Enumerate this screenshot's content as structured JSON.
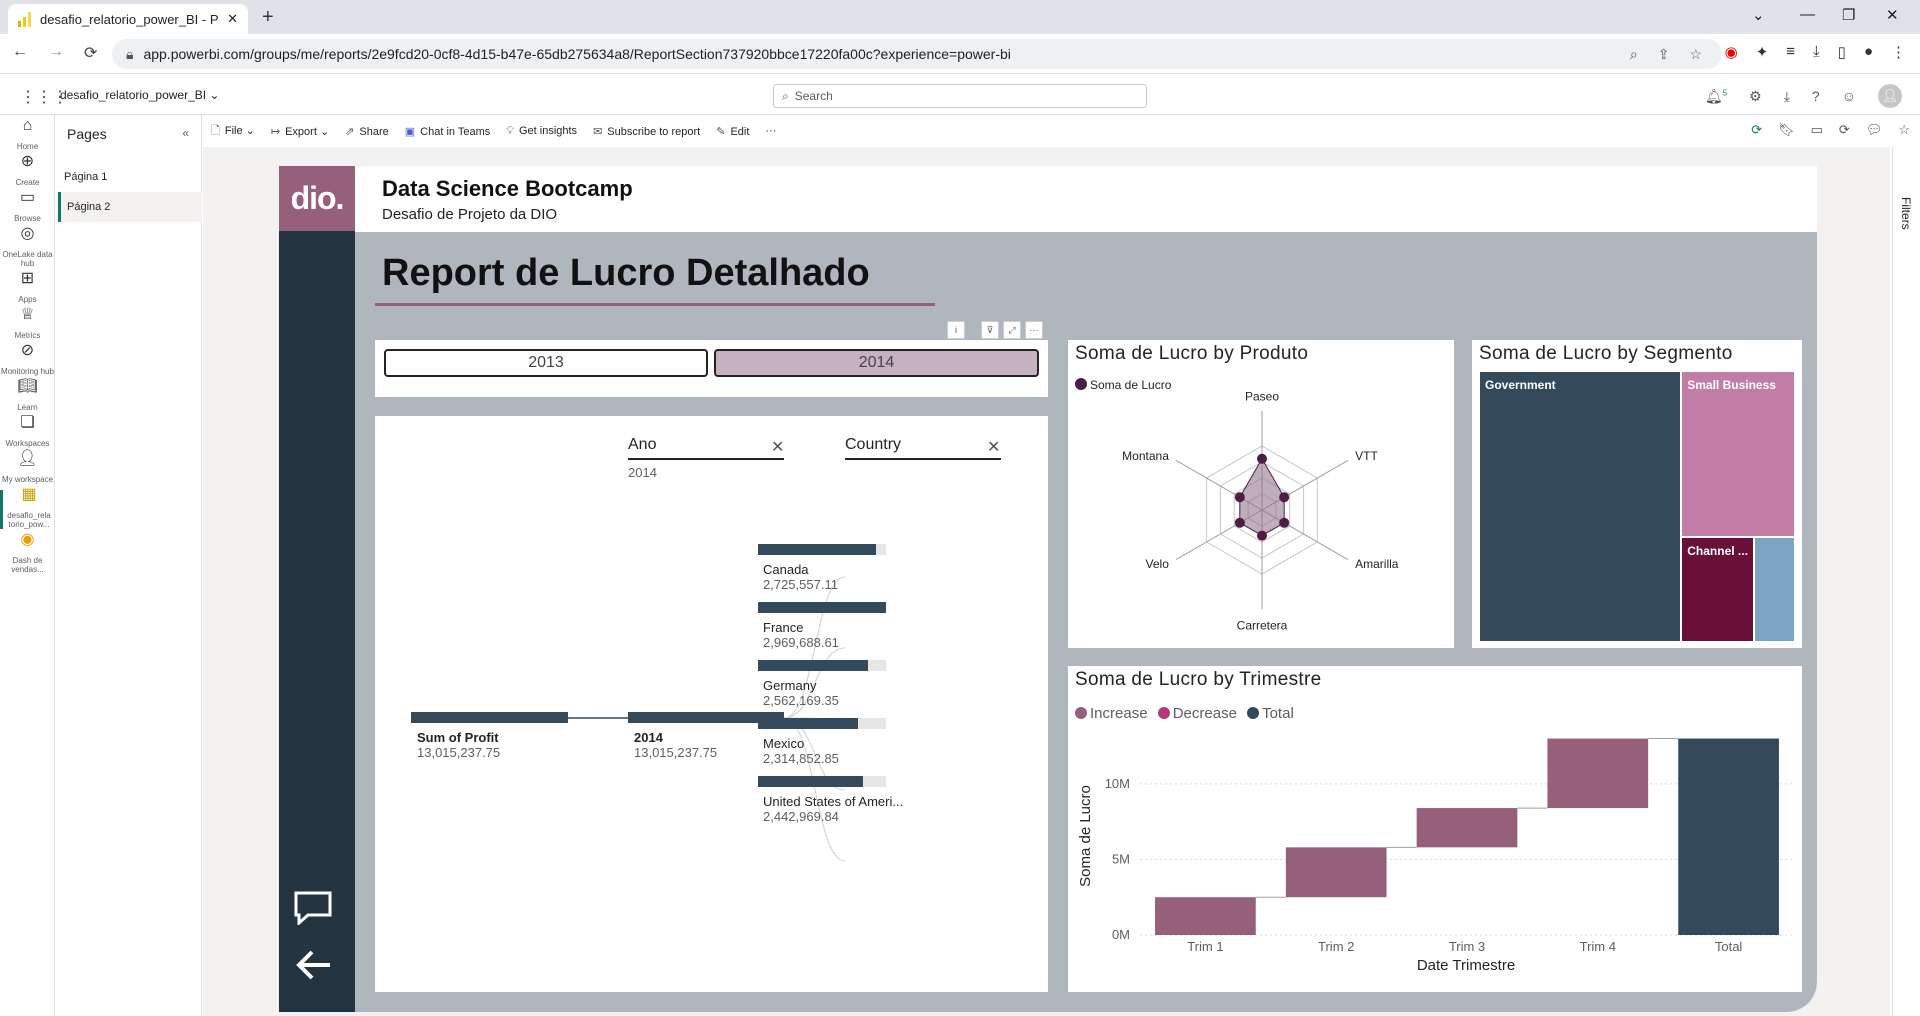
{
  "browser": {
    "tab_title": "desafio_relatorio_power_BI - Pov",
    "url": "app.powerbi.com/groups/me/reports/2e9fcd20-0cf8-4d15-b47e-65db275634a8/ReportSection737920bbce17220fa00c?experience=power-bi"
  },
  "header": {
    "report_name": "desafio_relatorio_power_BI",
    "search_placeholder": "Search",
    "notif_count": "5"
  },
  "rail": {
    "home": "Home",
    "create": "Create",
    "browse": "Browse",
    "onelake": "OneLake data hub",
    "apps": "Apps",
    "metrics": "Metrics",
    "monitoring": "Monitoring hub",
    "learn": "Learn",
    "workspaces": "Workspaces",
    "my_workspace": "My workspace",
    "current": "desafio_rela torio_pow...",
    "dash": "Dash de vendas..."
  },
  "pages_pane": {
    "title": "Pages",
    "pages": [
      "Página 1",
      "Página 2"
    ]
  },
  "actionbar": {
    "file": "File",
    "export": "Export",
    "share": "Share",
    "teams": "Chat in Teams",
    "insights": "Get insights",
    "subscribe": "Subscribe to report",
    "edit": "Edit"
  },
  "filters_label": "Filters",
  "report": {
    "logo": "dio.",
    "title": "Data Science Bootcamp",
    "subtitle": "Desafio de Projeto da DIO",
    "main_title": "Report de Lucro Detalhado",
    "slicer": {
      "options": [
        "2013",
        "2014"
      ],
      "selected": "2014"
    },
    "decomp": {
      "col1": "Ano",
      "col1_value": "2014",
      "col2": "Country",
      "root_label": "Sum of Profit",
      "root_value": "13,015,237.75",
      "level1_label": "2014",
      "level1_value": "13,015,237.75",
      "countries": [
        {
          "name": "Canada",
          "value": "2,725,557.11",
          "fraction": 0.92
        },
        {
          "name": "France",
          "value": "2,969,688.61",
          "fraction": 1.0
        },
        {
          "name": "Germany",
          "value": "2,562,169.35",
          "fraction": 0.86
        },
        {
          "name": "Mexico",
          "value": "2,314,852.85",
          "fraction": 0.78
        },
        {
          "name": "United States of Ameri...",
          "value": "2,442,969.84",
          "fraction": 0.82
        }
      ]
    }
  },
  "colors": {
    "purple": "#96607d",
    "dark": "#34495a",
    "pink": "#c27da6",
    "maroon": "#6a0f37",
    "blue": "#7ba3c2",
    "decrease": "#b23c7b"
  },
  "chart_data": [
    {
      "type": "radar",
      "title": "Soma de Lucro by Produto",
      "legend": [
        "Soma de Lucro"
      ],
      "categories": [
        "Paseo",
        "VTT",
        "Amarilla",
        "Carretera",
        "Velo",
        "Montana"
      ],
      "values": [
        0.8,
        0.4,
        0.4,
        0.4,
        0.4,
        0.4
      ]
    },
    {
      "type": "treemap",
      "title": "Soma de Lucro by Segmento",
      "categories": [
        "Government",
        "Small Business",
        "Channel ...",
        ""
      ],
      "values": [
        0.64,
        0.22,
        0.09,
        0.05
      ]
    },
    {
      "type": "waterfall",
      "title": "Soma de Lucro by Trimestre",
      "legend": [
        "Increase",
        "Decrease",
        "Total"
      ],
      "categories": [
        "Trim 1",
        "Trim 2",
        "Trim 3",
        "Trim 4",
        "Total"
      ],
      "values": [
        2.5,
        3.3,
        2.6,
        4.6,
        13.0
      ],
      "ylabel": "Soma de Lucro",
      "xlabel": "Date Trimestre",
      "yticks": [
        "0M",
        "5M",
        "10M"
      ],
      "ylim": [
        0,
        13.5
      ]
    }
  ]
}
